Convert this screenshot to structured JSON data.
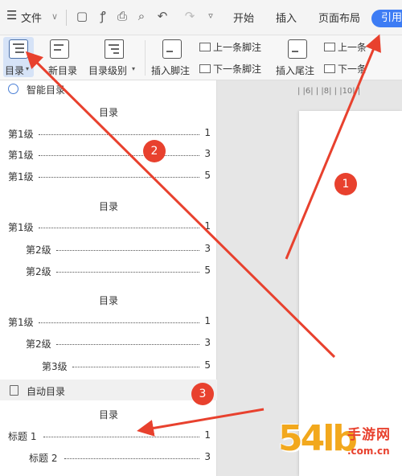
{
  "menubar": {
    "file_label": "文件",
    "tabs": [
      "开始",
      "插入",
      "页面布局",
      "引用"
    ]
  },
  "ribbon": {
    "toc_label": "目录",
    "update_toc_label": "新目录",
    "toc_level_label": "目录级别",
    "insert_footnote_label": "插入脚注",
    "prev_footnote_label": "上一条脚注",
    "next_footnote_label": "下一条脚注",
    "insert_endnote_label": "插入尾注",
    "prev_endnote_label": "上一条",
    "next_endnote_label": "下一条"
  },
  "ruler_label": "| |6|  | |8|  | |10| |",
  "panel": {
    "smart_section": "智能目录",
    "auto_section": "自动目录",
    "toc_title": "目录",
    "style1": [
      {
        "label": "第1级",
        "page": "1"
      },
      {
        "label": "第1级",
        "page": "3"
      },
      {
        "label": "第1级",
        "page": "5"
      }
    ],
    "style2": [
      {
        "label": "第1级",
        "page": "1"
      },
      {
        "label": "第2级",
        "page": "3"
      },
      {
        "label": "第2级",
        "page": "5"
      }
    ],
    "style3": [
      {
        "label": "第1级",
        "page": "1"
      },
      {
        "label": "第2级",
        "page": "3"
      },
      {
        "label": "第3级",
        "page": "5"
      }
    ],
    "auto": [
      {
        "label": "标题 1",
        "page": "1"
      },
      {
        "label": "标题 2",
        "page": "3"
      }
    ]
  },
  "badges": [
    "1",
    "2",
    "3"
  ],
  "colors": {
    "accent": "#3d7cf4",
    "arrow": "#e8412e"
  },
  "watermark": {
    "big": "54lb",
    "cn": "手游网",
    "domain": ".com.cn"
  }
}
